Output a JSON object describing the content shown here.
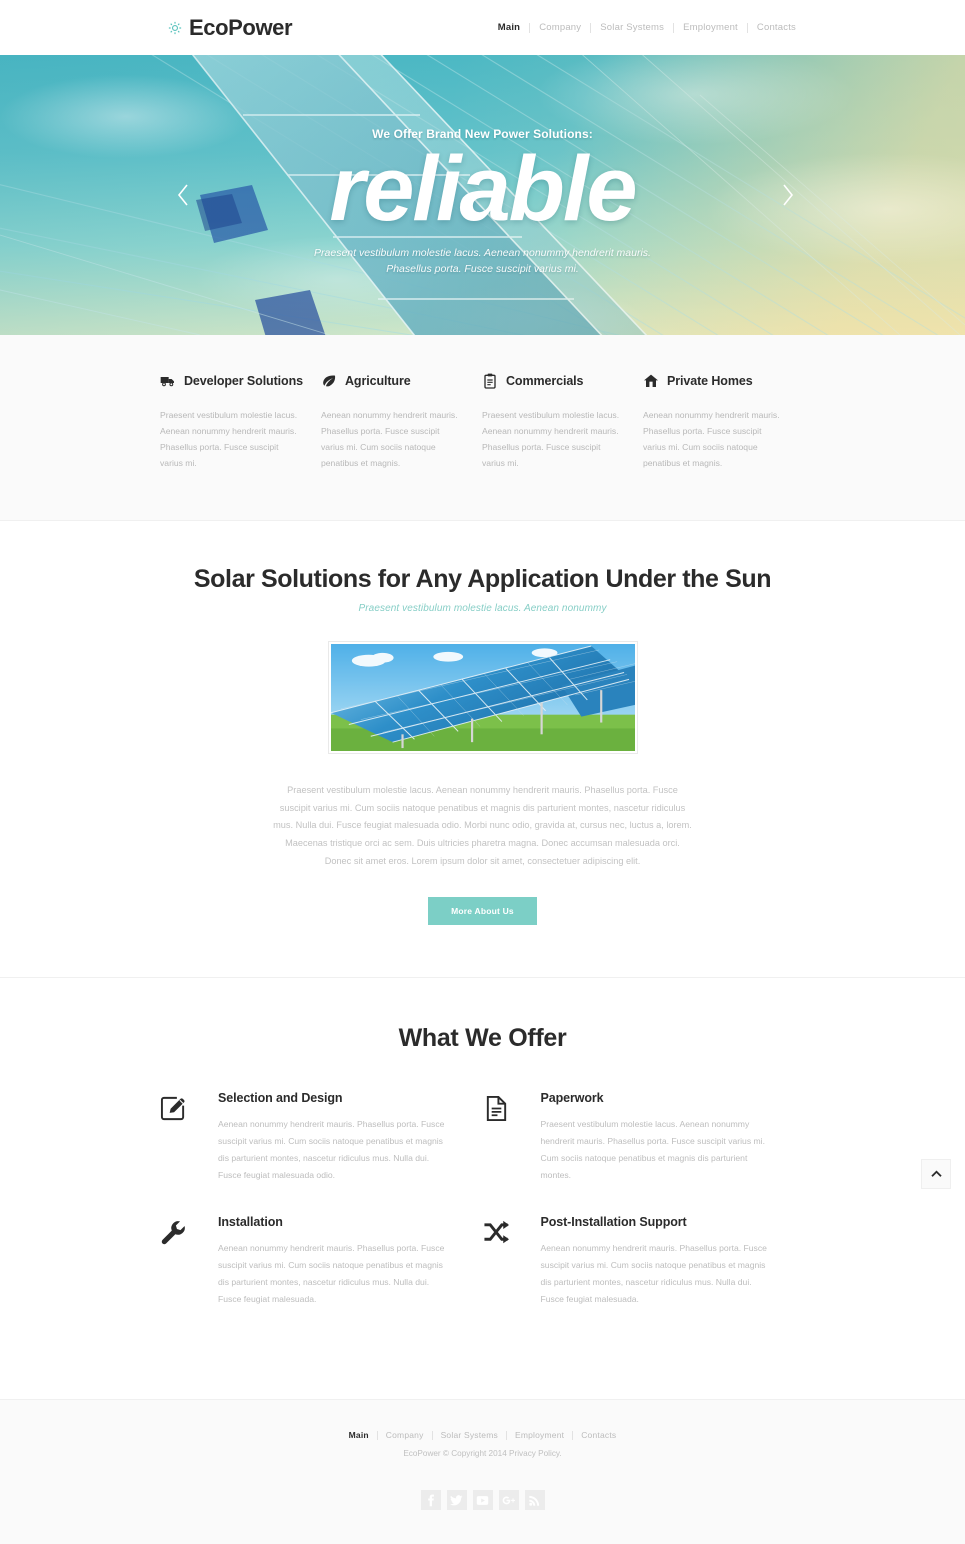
{
  "brand": {
    "name": "EcoPower",
    "logo_icon": "sun-gear-icon",
    "accent_color": "#7ccfc6",
    "text_color": "#2b2b2b"
  },
  "header": {
    "nav": [
      {
        "label": "Main",
        "active": true
      },
      {
        "label": "Company",
        "active": false
      },
      {
        "label": "Solar Systems",
        "active": false
      },
      {
        "label": "Employment",
        "active": false
      },
      {
        "label": "Contacts",
        "active": false
      }
    ]
  },
  "hero": {
    "eyebrow": "We Offer Brand New Power Solutions:",
    "title": "reliable",
    "subtitle_line1": "Praesent vestibulum molestie lacus. Aenean nonummy hendrerit mauris.",
    "subtitle_line2": "Phasellus porta. Fusce suscipit varius mi.",
    "prev_label": "Previous slide",
    "next_label": "Next slide",
    "prev_icon": "chevron-left-icon",
    "next_icon": "chevron-right-icon"
  },
  "features": [
    {
      "icon": "truck-icon",
      "title": "Developer Solutions",
      "text": "Praesent vestibulum molestie lacus. Aenean nonummy hendrerit mauris. Phasellus porta. Fusce suscipit varius mi."
    },
    {
      "icon": "leaf-icon",
      "title": "Agriculture",
      "text": "Aenean nonummy hendrerit mauris. Phasellus porta. Fusce suscipit varius mi. Cum sociis natoque penatibus et magnis."
    },
    {
      "icon": "clipboard-icon",
      "title": "Commercials",
      "text": "Praesent vestibulum molestie lacus. Aenean nonummy hendrerit mauris. Phasellus porta. Fusce suscipit varius mi."
    },
    {
      "icon": "home-icon",
      "title": "Private Homes",
      "text": "Aenean nonummy hendrerit mauris. Phasellus porta. Fusce suscipit varius mi. Cum sociis natoque penatibus et magnis."
    }
  ],
  "about": {
    "title": "Solar Solutions for Any Application Under the Sun",
    "subtitle": "Praesent vestibulum molestie  lacus. Aenean nonummy",
    "image_alt": "solar-panel-array-photo",
    "text": "Praesent vestibulum molestie lacus. Aenean nonummy hendrerit mauris. Phasellus porta. Fusce suscipit varius mi.  Cum sociis natoque penatibus et magnis dis parturient montes, nascetur ridiculus mus. Nulla dui. Fusce feugiat malesuada odio. Morbi nunc odio, gravida at, cursus nec, luctus a, lorem. Maecenas tristique orci ac sem. Duis ultricies pharetra magna. Donec accumsan malesuada orci. Donec sit amet eros. Lorem ipsum dolor sit amet, consectetuer adipiscing elit.",
    "button_label": "More About Us"
  },
  "offer": {
    "title": "What We Offer",
    "items": [
      {
        "icon": "pencil-edit-icon",
        "name": "Selection and Design",
        "text": "Aenean nonummy hendrerit mauris. Phasellus porta. Fusce suscipit varius mi. Cum sociis natoque penatibus et magnis dis parturient montes, nascetur ridiculus mus. Nulla dui. Fusce feugiat malesuada odio."
      },
      {
        "icon": "document-icon",
        "name": "Paperwork",
        "text": "Praesent vestibulum molestie lacus. Aenean nonummy hendrerit mauris. Phasellus porta. Fusce suscipit varius mi. Cum sociis natoque penatibus et magnis dis parturient montes."
      },
      {
        "icon": "wrench-icon",
        "name": "Installation",
        "text": "Aenean nonummy hendrerit mauris. Phasellus porta. Fusce suscipit varius mi. Cum sociis natoque penatibus et magnis dis parturient montes, nascetur ridiculus mus. Nulla dui. Fusce feugiat malesuada."
      },
      {
        "icon": "shuffle-arrows-icon",
        "name": "Post-Installation Support",
        "text": "Aenean nonummy hendrerit mauris. Phasellus porta. Fusce suscipit varius mi. Cum sociis natoque penatibus et magnis dis parturient montes, nascetur ridiculus mus. Nulla dui. Fusce feugiat malesuada."
      }
    ]
  },
  "to_top": {
    "icon": "chevron-up-icon",
    "label": "Back to top"
  },
  "footer": {
    "nav": [
      {
        "label": "Main",
        "active": true
      },
      {
        "label": "Company",
        "active": false
      },
      {
        "label": "Solar Systems",
        "active": false
      },
      {
        "label": "Employment",
        "active": false
      },
      {
        "label": "Contacts",
        "active": false
      }
    ],
    "copyright": "EcoPower © Copyright 2014",
    "privacy_label": "Privacy Policy.",
    "socials": [
      {
        "icon": "facebook-icon",
        "label": "Facebook"
      },
      {
        "icon": "twitter-icon",
        "label": "Twitter"
      },
      {
        "icon": "youtube-icon",
        "label": "YouTube"
      },
      {
        "icon": "google-plus-icon",
        "label": "Google Plus"
      },
      {
        "icon": "rss-icon",
        "label": "RSS"
      }
    ]
  }
}
